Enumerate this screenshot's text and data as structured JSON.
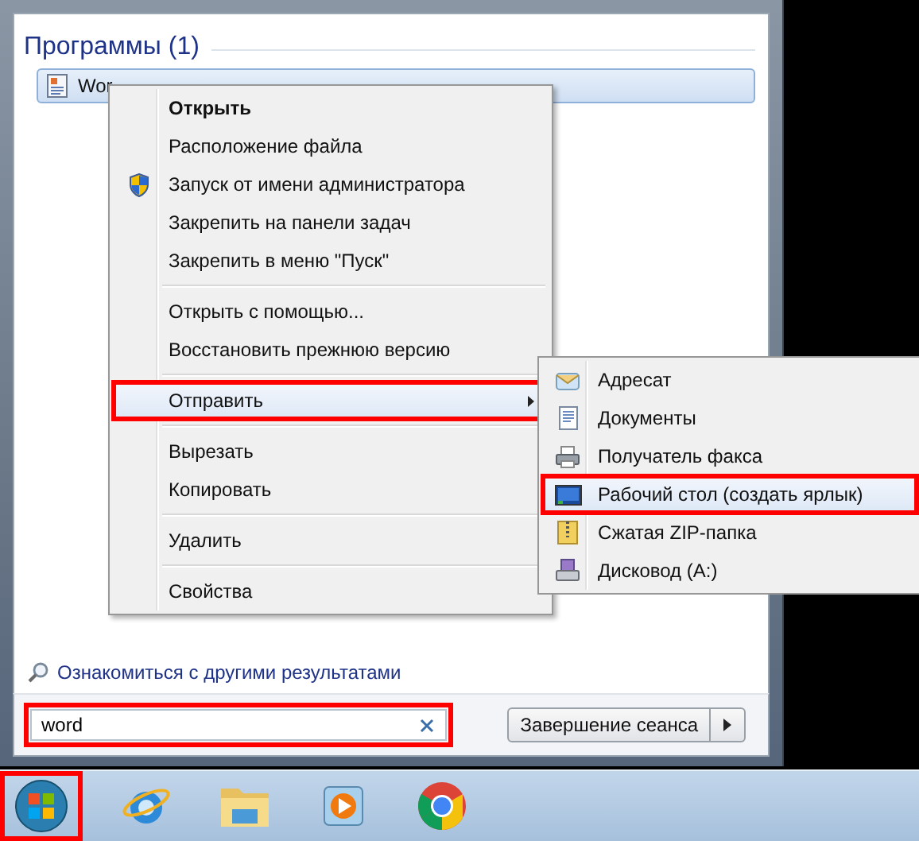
{
  "programs_header": "Программы (1)",
  "program": {
    "label": "Wor"
  },
  "context_menu": {
    "groups": [
      [
        {
          "label": "Открыть",
          "default": true,
          "kind": "plain",
          "selected": false,
          "submenu": false,
          "annotated": false
        },
        {
          "label": "Расположение файла",
          "default": false,
          "kind": "plain",
          "selected": false,
          "submenu": false,
          "annotated": false
        },
        {
          "label": "Запуск от имени администратора",
          "default": false,
          "kind": "shield",
          "selected": false,
          "submenu": false,
          "annotated": false
        },
        {
          "label": "Закрепить на панели задач",
          "default": false,
          "kind": "plain",
          "selected": false,
          "submenu": false,
          "annotated": false
        },
        {
          "label": "Закрепить в меню \"Пуск\"",
          "default": false,
          "kind": "plain",
          "selected": false,
          "submenu": false,
          "annotated": false
        }
      ],
      [
        {
          "label": "Открыть с помощью...",
          "default": false,
          "kind": "plain",
          "selected": false,
          "submenu": false,
          "annotated": false
        },
        {
          "label": "Восстановить прежнюю версию",
          "default": false,
          "kind": "plain",
          "selected": false,
          "submenu": false,
          "annotated": false
        }
      ],
      [
        {
          "label": "Отправить",
          "default": false,
          "kind": "plain",
          "selected": true,
          "submenu": true,
          "annotated": true
        }
      ],
      [
        {
          "label": "Вырезать",
          "default": false,
          "kind": "plain",
          "selected": false,
          "submenu": false,
          "annotated": false
        },
        {
          "label": "Копировать",
          "default": false,
          "kind": "plain",
          "selected": false,
          "submenu": false,
          "annotated": false
        }
      ],
      [
        {
          "label": "Удалить",
          "default": false,
          "kind": "plain",
          "selected": false,
          "submenu": false,
          "annotated": false
        }
      ],
      [
        {
          "label": "Свойства",
          "default": false,
          "kind": "plain",
          "selected": false,
          "submenu": false,
          "annotated": false
        }
      ]
    ]
  },
  "send_to_menu": {
    "items": [
      {
        "label": "Адресат",
        "kind": "mail",
        "selected": false,
        "annotated": false
      },
      {
        "label": "Документы",
        "kind": "document",
        "selected": false,
        "annotated": false
      },
      {
        "label": "Получатель факса",
        "kind": "fax",
        "selected": false,
        "annotated": false
      },
      {
        "label": "Рабочий стол (создать ярлык)",
        "kind": "desktop",
        "selected": true,
        "annotated": true
      },
      {
        "label": "Сжатая ZIP-папка",
        "kind": "zip",
        "selected": false,
        "annotated": false
      },
      {
        "label": "Дисковод (A:)",
        "kind": "drive",
        "selected": false,
        "annotated": false
      }
    ]
  },
  "more_results_link": "Ознакомиться с другими результатами",
  "search": {
    "value": "word",
    "annotated": true
  },
  "shutdown_button": "Завершение сеанса",
  "taskbar": {
    "start_annotated": true,
    "apps": [
      {
        "kind": "browser-e"
      },
      {
        "kind": "folder"
      },
      {
        "kind": "player"
      },
      {
        "kind": "chrome"
      }
    ]
  }
}
